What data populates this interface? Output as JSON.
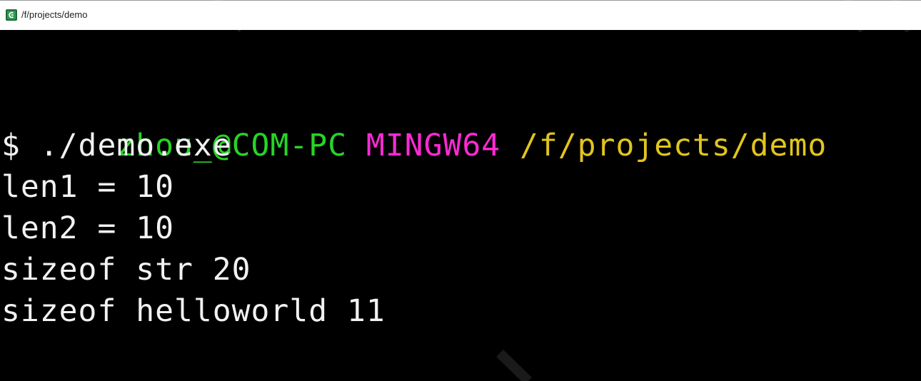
{
  "window": {
    "title": "/f/projects/demo"
  },
  "terminal": {
    "prompt": {
      "user_host": "zhou_@COM-PC",
      "system": "MINGW64",
      "path": "/f/projects/demo"
    },
    "command_line": "$ ./demo.exe",
    "output": [
      "len1 = 10",
      "len2 = 10",
      "sizeof str 20",
      "sizeof helloworld 11"
    ]
  },
  "colors": {
    "user_host": "#27d427",
    "system": "#ff2ad4",
    "path": "#e2c51d",
    "text": "#f2f2f2",
    "background": "#000000"
  },
  "icons": {
    "app": "mintty-icon"
  }
}
